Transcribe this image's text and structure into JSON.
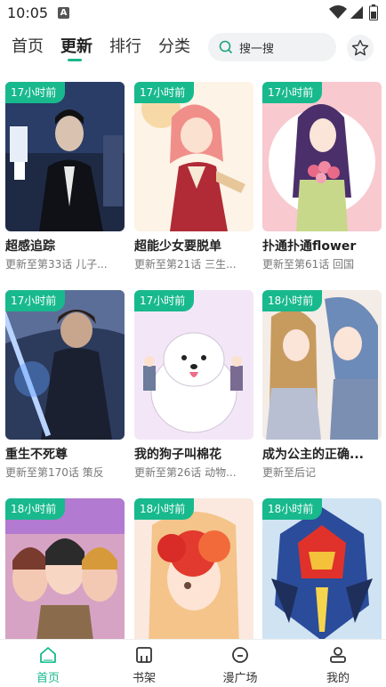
{
  "status": {
    "time": "10:05",
    "a_icon": "A"
  },
  "nav": {
    "tabs": [
      {
        "label": "首页"
      },
      {
        "label": "更新"
      },
      {
        "label": "排行"
      },
      {
        "label": "分类"
      }
    ],
    "active_index": 1,
    "search_placeholder": "搜一搜"
  },
  "comics": [
    {
      "tag": "17小时前",
      "title": "超感追踪",
      "sub": "更新至第33话 儿子..."
    },
    {
      "tag": "17小时前",
      "title": "超能少女要脱单",
      "sub": "更新至第21话 三生..."
    },
    {
      "tag": "17小时前",
      "title": "扑通扑通flower",
      "sub": "更新至第61话 回国"
    },
    {
      "tag": "17小时前",
      "title": "重生不死尊",
      "sub": "更新至第170话 策反"
    },
    {
      "tag": "17小时前",
      "title": "我的狗子叫棉花",
      "sub": "更新至第26话 动物..."
    },
    {
      "tag": "18小时前",
      "title": "成为公主的正确...",
      "sub": "更新至后记"
    },
    {
      "tag": "18小时前",
      "title": "",
      "sub": ""
    },
    {
      "tag": "18小时前",
      "title": "",
      "sub": ""
    },
    {
      "tag": "18小时前",
      "title": "",
      "sub": ""
    }
  ],
  "bottom_nav": [
    {
      "label": "首页",
      "icon": "home-icon"
    },
    {
      "label": "书架",
      "icon": "bookshelf-icon"
    },
    {
      "label": "漫广场",
      "icon": "square-icon"
    },
    {
      "label": "我的",
      "icon": "profile-icon"
    }
  ],
  "colors": {
    "accent": "#18b98d"
  }
}
